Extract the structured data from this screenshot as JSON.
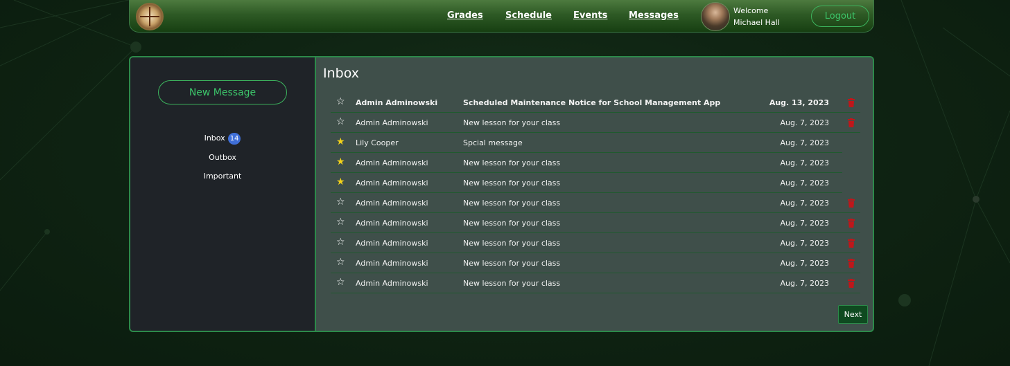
{
  "nav": {
    "links": [
      "Grades",
      "Schedule",
      "Events",
      "Messages"
    ],
    "welcome_line1": "Welcome",
    "welcome_line2": "Michael Hall",
    "logout_label": "Logout"
  },
  "sidebar": {
    "new_message_label": "New Message",
    "inbox_label": "Inbox",
    "inbox_count": "14",
    "outbox_label": "Outbox",
    "important_label": "Important"
  },
  "main": {
    "title": "Inbox",
    "next_label": "Next",
    "messages": [
      {
        "sender": "Admin Adminowski",
        "subject": "Scheduled Maintenance Notice for School Management App",
        "date": "Aug. 13, 2023",
        "starred": false,
        "unread": true,
        "deletable": true
      },
      {
        "sender": "Admin Adminowski",
        "subject": "New lesson for your class",
        "date": "Aug. 7, 2023",
        "starred": false,
        "unread": false,
        "deletable": true
      },
      {
        "sender": "Lily Cooper",
        "subject": "Spcial message",
        "date": "Aug. 7, 2023",
        "starred": true,
        "unread": false,
        "deletable": false
      },
      {
        "sender": "Admin Adminowski",
        "subject": "New lesson for your class",
        "date": "Aug. 7, 2023",
        "starred": true,
        "unread": false,
        "deletable": false
      },
      {
        "sender": "Admin Adminowski",
        "subject": "New lesson for your class",
        "date": "Aug. 7, 2023",
        "starred": true,
        "unread": false,
        "deletable": false
      },
      {
        "sender": "Admin Adminowski",
        "subject": "New lesson for your class",
        "date": "Aug. 7, 2023",
        "starred": false,
        "unread": false,
        "deletable": true
      },
      {
        "sender": "Admin Adminowski",
        "subject": "New lesson for your class",
        "date": "Aug. 7, 2023",
        "starred": false,
        "unread": false,
        "deletable": true
      },
      {
        "sender": "Admin Adminowski",
        "subject": "New lesson for your class",
        "date": "Aug. 7, 2023",
        "starred": false,
        "unread": false,
        "deletable": true
      },
      {
        "sender": "Admin Adminowski",
        "subject": "New lesson for your class",
        "date": "Aug. 7, 2023",
        "starred": false,
        "unread": false,
        "deletable": true
      },
      {
        "sender": "Admin Adminowski",
        "subject": "New lesson for your class",
        "date": "Aug. 7, 2023",
        "starred": false,
        "unread": false,
        "deletable": true
      }
    ]
  },
  "colors": {
    "accent": "#3cc56a",
    "star_on": "#f3d21a",
    "trash": "#c0161a",
    "badge": "#3f6fd8"
  }
}
